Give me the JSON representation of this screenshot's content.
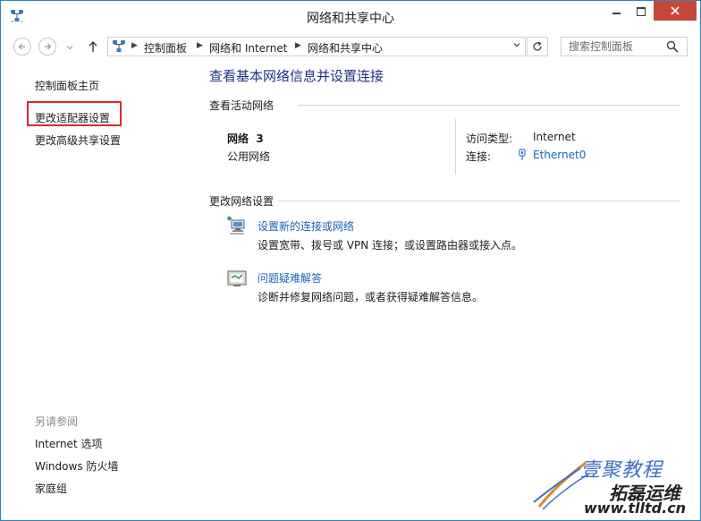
{
  "window": {
    "title": "网络和共享中心"
  },
  "address": {
    "crumbs": [
      "控制面板",
      "网络和 Internet",
      "网络和共享中心"
    ],
    "search_placeholder": "搜索控制面板"
  },
  "sidebar": {
    "items": [
      {
        "label": "控制面板主页"
      },
      {
        "label": "更改适配器设置"
      },
      {
        "label": "更改高级共享设置"
      }
    ],
    "see_also_heading": "另请参阅",
    "see_also": [
      {
        "label": "Internet 选项"
      },
      {
        "label": "Windows 防火墙"
      },
      {
        "label": "家庭组"
      }
    ]
  },
  "main": {
    "title": "查看基本网络信息并设置连接",
    "active_networks_heading": "查看活动网络",
    "network": {
      "name": "网络  3",
      "category": "公用网络",
      "access_type_label": "访问类型:",
      "access_type_value": "Internet",
      "connections_label": "连接:",
      "connection_value": "Ethernet0"
    },
    "change_settings_heading": "更改网络设置",
    "tasks": [
      {
        "link": "设置新的连接或网络",
        "desc": "设置宽带、拨号或 VPN 连接；或设置路由器或接入点。",
        "icon": "network-setup-icon"
      },
      {
        "link": "问题疑难解答",
        "desc": "诊断并修复网络问题，或者获得疑难解答信息。",
        "icon": "troubleshoot-icon"
      }
    ]
  },
  "watermark": {
    "line1": "壹聚教程",
    "line2": "拓磊运维",
    "line3": "www.tlltd.cn"
  },
  "colors": {
    "accent_border": "#2b86c9",
    "close_button": "#c7463a",
    "title_blue": "#1e3287",
    "link_blue": "#1c63b7",
    "highlight_red": "#e0252b"
  }
}
